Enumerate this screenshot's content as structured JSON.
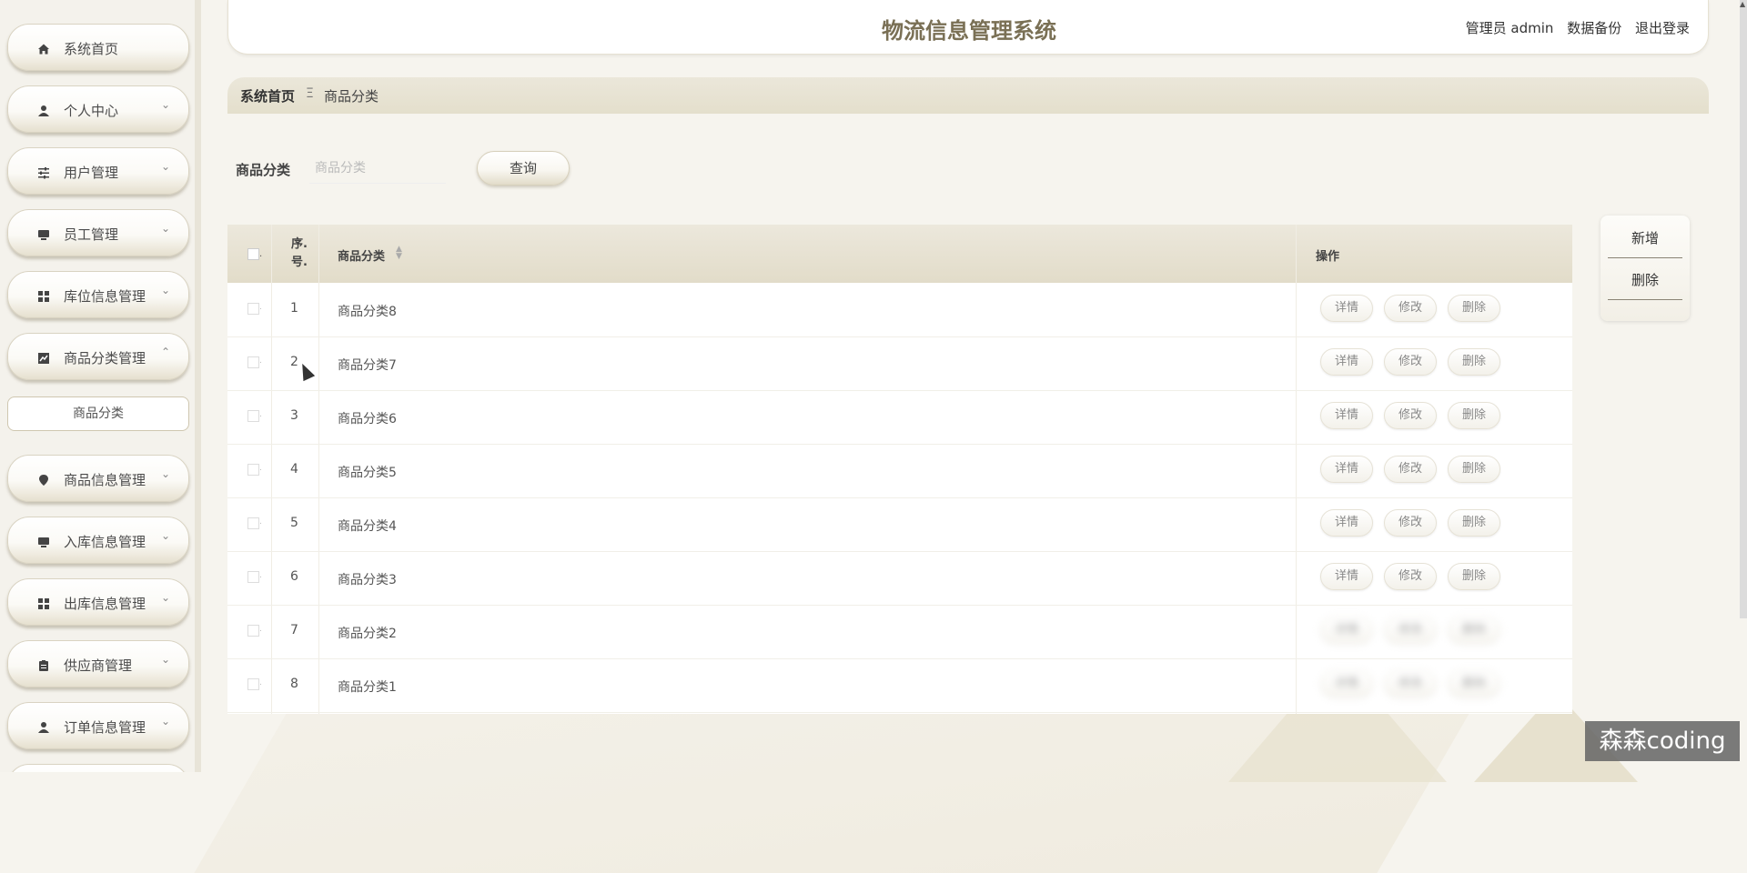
{
  "app": {
    "title": "物流信息管理系统"
  },
  "header": {
    "admin_label": "管理员 admin",
    "backup_label": "数据备份",
    "logout_label": "退出登录"
  },
  "sidebar": {
    "items": [
      {
        "label": "系统首页",
        "icon": "home-icon",
        "expandable": false
      },
      {
        "label": "个人中心",
        "icon": "user-icon",
        "expandable": true
      },
      {
        "label": "用户管理",
        "icon": "sliders-icon",
        "expandable": true
      },
      {
        "label": "员工管理",
        "icon": "monitor-icon",
        "expandable": true
      },
      {
        "label": "库位信息管理",
        "icon": "grid-icon",
        "expandable": true
      },
      {
        "label": "商品分类管理",
        "icon": "chart-icon",
        "expandable": true,
        "expanded": true
      },
      {
        "label": "商品信息管理",
        "icon": "location-icon",
        "expandable": true
      },
      {
        "label": "入库信息管理",
        "icon": "monitor-icon",
        "expandable": true
      },
      {
        "label": "出库信息管理",
        "icon": "grid-icon",
        "expandable": true
      },
      {
        "label": "供应商管理",
        "icon": "clipboard-icon",
        "expandable": true
      },
      {
        "label": "订单信息管理",
        "icon": "user-icon",
        "expandable": true
      }
    ],
    "sub_item": "商品分类"
  },
  "breadcrumb": {
    "home": "系统首页",
    "separator": "Ξ",
    "current": "商品分类"
  },
  "search": {
    "label": "商品分类",
    "placeholder": "商品分类",
    "value": "",
    "button": "查询"
  },
  "table": {
    "headers": {
      "seq": "序.号.",
      "name": "商品分类",
      "ops": "操作"
    },
    "rows": [
      {
        "seq": "1",
        "name": "商品分类8"
      },
      {
        "seq": "2",
        "name": "商品分类7"
      },
      {
        "seq": "3",
        "name": "商品分类6"
      },
      {
        "seq": "4",
        "name": "商品分类5"
      },
      {
        "seq": "5",
        "name": "商品分类4"
      },
      {
        "seq": "6",
        "name": "商品分类3"
      },
      {
        "seq": "7",
        "name": "商品分类2"
      },
      {
        "seq": "8",
        "name": "商品分类1"
      }
    ],
    "ops": {
      "detail": "详情",
      "edit": "修改",
      "delete": "删除"
    }
  },
  "actions": {
    "add": "新增",
    "delete": "删除"
  },
  "watermark": "森森coding",
  "colors": {
    "accent": "#7a7055",
    "bar": "#e4dfcc"
  }
}
